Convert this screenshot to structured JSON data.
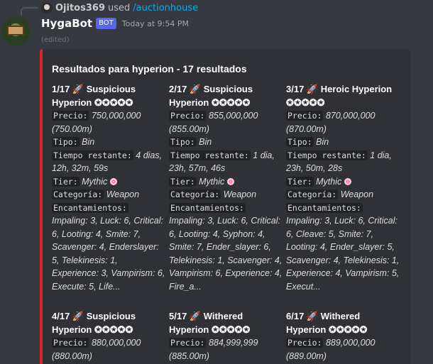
{
  "reply": {
    "user": "Ojitos369",
    "used": "used",
    "command": "/auctionhouse"
  },
  "message": {
    "username": "HygaBot",
    "badge": "BOT",
    "timestamp": "Today at 9:54 PM",
    "edited": "(edited)"
  },
  "embed": {
    "color": "#e0232b",
    "title": "Resultados para hyperion - 17 resultados",
    "labels": {
      "precio": "Precio:",
      "tipo": "Tipo:",
      "tiempo": "Tiempo restante:",
      "tier": "Tier:",
      "categoria": "Categoría:",
      "encantamientos": "Encantamientos:"
    },
    "items": [
      {
        "title": "1/17 🚀 Suspicious Hyperion ✪✪✪✪✪",
        "precio": "750,000,000 (750.00m)",
        "tipo": "Bin",
        "tiempo": "4 dias, 12h, 32m, 59s",
        "tier": "Mythic",
        "categoria": "Weapon",
        "encantamientos": "Impaling: 3, Luck: 6, Critical: 6, Looting: 4, Smite: 7, Scavenger: 4, Enderslayer: 5, Telekinesis: 1, Experience: 3, Vampirism: 6, Execute: 5, Life..."
      },
      {
        "title": "2/17 🚀 Suspicious Hyperion ✪✪✪✪✪",
        "precio": "855,000,000 (855.00m)",
        "tipo": "Bin",
        "tiempo": "1 dia, 23h, 57m, 46s",
        "tier": "Mythic",
        "categoria": "Weapon",
        "encantamientos": "Impaling: 3, Luck: 6, Critical: 6, Looting: 4, Syphon: 4, Smite: 7, Ender_slayer: 6, Telekinesis: 1, Scavenger: 4, Vampirism: 6, Experience: 4, Fire_a..."
      },
      {
        "title": "3/17 🚀 Heroic Hyperion ✪✪✪✪✪",
        "precio": "870,000,000 (870.00m)",
        "tipo": "Bin",
        "tiempo": "1 dia, 23h, 50m, 28s",
        "tier": "Mythic",
        "categoria": "Weapon",
        "encantamientos": "Impaling: 3, Luck: 6, Critical: 6, Cleave: 5, Smite: 7, Looting: 4, Ender_slayer: 5, Scavenger: 4, Telekinesis: 1, Experience: 4, Vampirism: 5, Execut..."
      },
      {
        "title": "4/17 🚀 Suspicious Hyperion ✪✪✪✪✪",
        "precio": "880,000,000 (880.00m)"
      },
      {
        "title": "5/17 🚀 Withered Hyperion ✪✪✪✪✪",
        "precio": "884,999,999 (885.00m)"
      },
      {
        "title": "6/17 🚀 Withered Hyperion ✪✪✪✪✪",
        "precio": "889,000,000 (889.00m)"
      }
    ]
  }
}
